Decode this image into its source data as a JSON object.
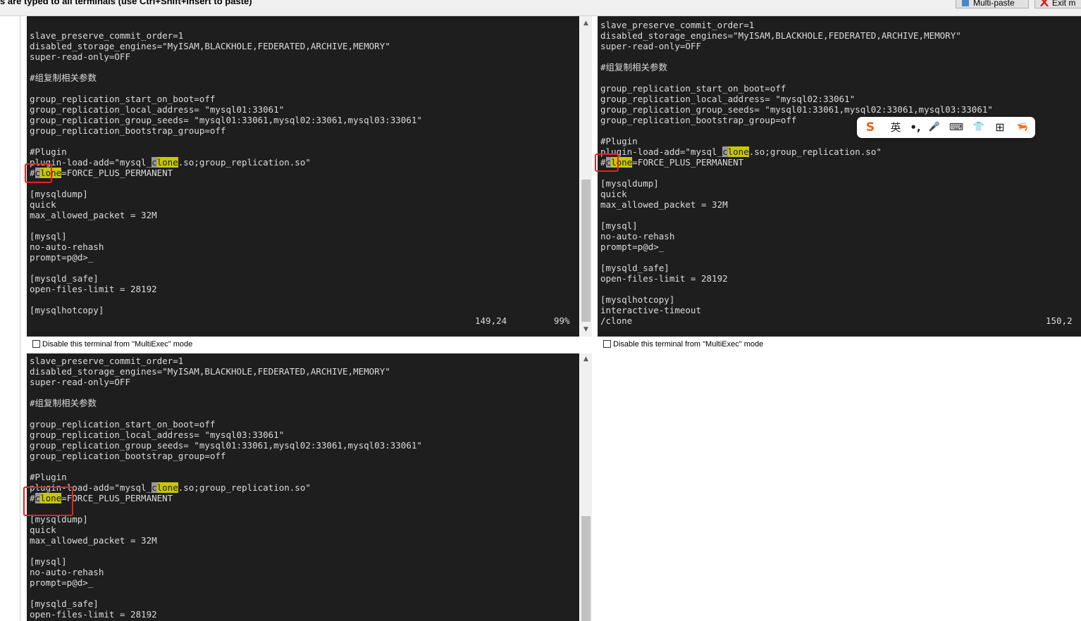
{
  "toolbar": {
    "hint": "s are typed to all terminals (use Ctrl+Shift+Insert to paste)",
    "multipaste_label": "Multi-paste",
    "exit_label": "Exit m"
  },
  "terminals": {
    "t1": {
      "lines": [
        "slave_preserve_commit_order=1",
        "disabled_storage_engines=\"MyISAM,BLACKHOLE,FEDERATED,ARCHIVE,MEMORY\"",
        "super-read-only=OFF",
        "",
        "#组复制相关参数",
        "",
        "group_replication_start_on_boot=off",
        "group_replication_local_address= \"mysql01:33061\"",
        "group_replication_group_seeds= \"mysql01:33061,mysql02:33061,mysql03:33061\"",
        "group_replication_bootstrap_group=off",
        "",
        "#Plugin",
        "plugin-load-add=\"mysql_clone.so;group_replication.so\"",
        "#clone=FORCE_PLUS_PERMANENT",
        "",
        "[mysqldump]",
        "quick",
        "max_allowed_packet = 32M",
        "",
        "[mysql]",
        "no-auto-rehash",
        "prompt=p@d>_",
        "",
        "[mysqld_safe]",
        "open-files-limit = 28192",
        "",
        "[mysqlhotcopy]"
      ],
      "status_pos": "149,24",
      "status_pct": "99%"
    },
    "t2": {
      "lines": [
        "slave_preserve_commit_order=1",
        "disabled_storage_engines=\"MyISAM,BLACKHOLE,FEDERATED,ARCHIVE,MEMORY\"",
        "super-read-only=OFF",
        "",
        "#组复制相关参数",
        "",
        "group_replication_start_on_boot=off",
        "group_replication_local_address= \"mysql02:33061\"",
        "group_replication_group_seeds= \"mysql01:33061,mysql02:33061,mysql03:33061\"",
        "group_replication_bootstrap_group=off",
        "",
        "#Plugin",
        "plugin-load-add=\"mysql_clone.so;group_replication.so\"",
        "#clone=FORCE_PLUS_PERMANENT",
        "",
        "[mysqldump]",
        "quick",
        "max_allowed_packet = 32M",
        "",
        "[mysql]",
        "no-auto-rehash",
        "prompt=p@d>_",
        "",
        "[mysqld_safe]",
        "open-files-limit = 28192",
        "",
        "[mysqlhotcopy]",
        "interactive-timeout",
        "/clone"
      ],
      "status_pos": "150,2"
    },
    "t3": {
      "lines": [
        "slave_preserve_commit_order=1",
        "disabled_storage_engines=\"MyISAM,BLACKHOLE,FEDERATED,ARCHIVE,MEMORY\"",
        "super-read-only=OFF",
        "",
        "#组复制相关参数",
        "",
        "group_replication_start_on_boot=off",
        "group_replication_local_address= \"mysql03:33061\"",
        "group_replication_group_seeds= \"mysql01:33061,mysql02:33061,mysql03:33061\"",
        "group_replication_bootstrap_group=off",
        "",
        "#Plugin",
        "plugin-load-add=\"mysql_clone.so;group_replication.so\"",
        "#clone=FORCE_PLUS_PERMANENT",
        "",
        "[mysqldump]",
        "quick",
        "max_allowed_packet = 32M",
        "",
        "[mysql]",
        "no-auto-rehash",
        "prompt=p@d>_",
        "",
        "[mysqld_safe]",
        "open-files-limit = 28192"
      ]
    }
  },
  "checkbox_label": "Disable this terminal from \"MultiExec\" mode",
  "ime": {
    "items": [
      "S",
      "英",
      "•,",
      "🎤",
      "⌨",
      "👕",
      "⊞",
      "🦐"
    ]
  },
  "colors": {
    "terminal_bg": "#1e1e1e",
    "terminal_fg": "#dcdcdc",
    "search_highlight": "#c8c800",
    "annotation_red": "#e52222"
  }
}
